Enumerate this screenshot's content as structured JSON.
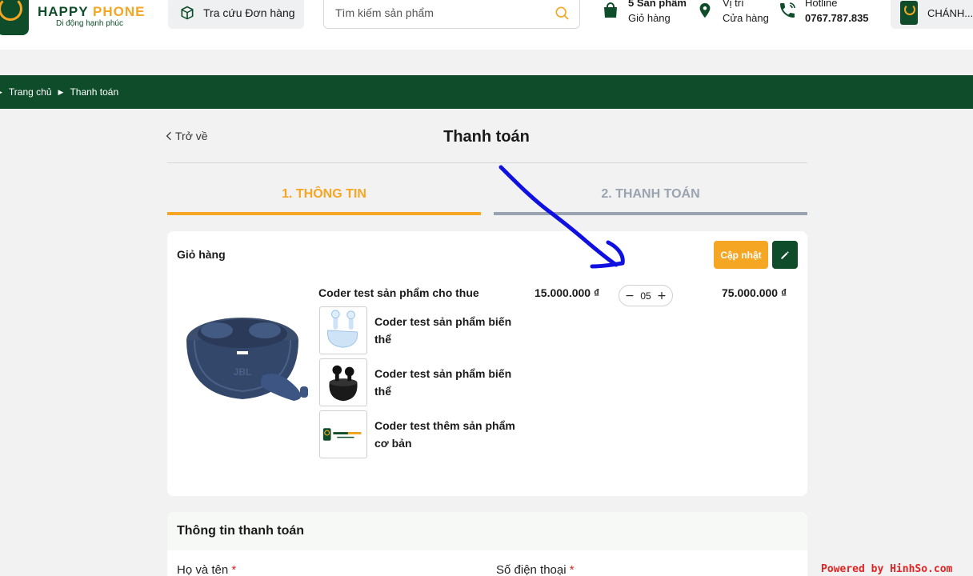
{
  "header": {
    "logo_text_1": "HAPPY",
    "logo_text_2": " PHONE",
    "logo_tagline": "Di động hạnh phúc",
    "order_lookup_label": "Tra cứu Đơn hàng",
    "search_placeholder": "Tìm kiếm sản phẩm",
    "cart_count": "5 Sản phẩm",
    "cart_label": "Giỏ hàng",
    "location_top": "Vị trí",
    "location_label": "Cửa hàng",
    "hotline_label": "Hotline",
    "hotline_number": "0767.787.835",
    "user_name": "CHÁNH..."
  },
  "breadcrumb": {
    "home": "Trang chủ",
    "current": "Thanh toán"
  },
  "page": {
    "back_label": "Trở về",
    "title": "Thanh toán"
  },
  "steps": [
    {
      "label": "1. THÔNG TIN"
    },
    {
      "label": "2. THANH TOÁN"
    }
  ],
  "cart": {
    "title": "Giỏ hàng",
    "update_label": "Cập nhật",
    "product": {
      "name": "Coder test sản phẩm cho thue",
      "price": "15.000.000 ₫",
      "quantity": "05",
      "total": "75.000.000 ₫"
    },
    "variants": [
      {
        "name": "Coder test sản phẩm biến thể"
      },
      {
        "name": "Coder test sản phẩm biến thể"
      },
      {
        "name": "Coder test thêm sản phẩm cơ bản"
      }
    ]
  },
  "payment_info": {
    "title": "Thông tin thanh toán",
    "full_name_label": "Họ và tên",
    "phone_label": "Số điện thoại",
    "required_mark": "*"
  },
  "watermark": "Powered by HinhSo.com",
  "colors": {
    "brand_green": "#0f4d2a",
    "brand_orange": "#f5a623",
    "annotation_blue": "#1010e0"
  }
}
